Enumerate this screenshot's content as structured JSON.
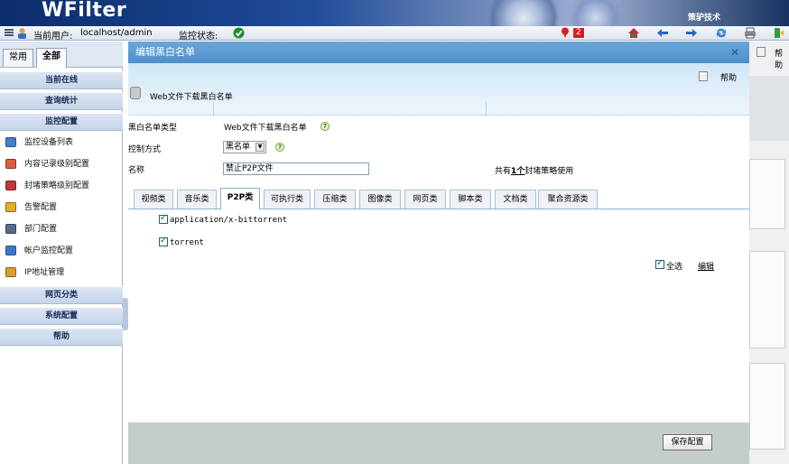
{
  "app": {
    "logo": "WFilter",
    "company": "策驴技术"
  },
  "statusbar": {
    "current_user_label": "当前用户:",
    "current_user": "localhost/admin",
    "monitor_status_label": "监控状态:",
    "alert_count": "2"
  },
  "sidebar": {
    "tabs": [
      "常用",
      "全部"
    ],
    "active_tab": "全部",
    "groups": [
      {
        "label": "当前在线"
      },
      {
        "label": "查询统计"
      },
      {
        "label": "监控配置"
      }
    ],
    "items": [
      {
        "label": "监控设备列表",
        "icon": "monitor-icon"
      },
      {
        "label": "内容记录级别配置",
        "icon": "record-icon"
      },
      {
        "label": "封堵策略级别配置",
        "icon": "block-icon"
      },
      {
        "label": "告警配置",
        "icon": "alert-icon"
      },
      {
        "label": "部门配置",
        "icon": "department-icon"
      },
      {
        "label": "帐户监控配置",
        "icon": "account-icon"
      },
      {
        "label": "IP地址管理",
        "icon": "ip-icon"
      }
    ],
    "groups_bottom": [
      {
        "label": "网页分类"
      },
      {
        "label": "系统配置"
      },
      {
        "label": "帮助"
      }
    ]
  },
  "dialog": {
    "title": "编辑黑白名单",
    "help": "帮助",
    "subtitle": "Web文件下载黑白名单",
    "type_label": "黑白名单类型",
    "type_value": "Web文件下载黑白名单",
    "mode_label": "控制方式",
    "mode_value": "黑名单",
    "name_label": "名称",
    "name_value": "禁止P2P文件",
    "policy_count_prefix": "共有",
    "policy_count_link": "1个",
    "policy_count_suffix": "封堵策略使用",
    "category_tabs": [
      "视频类",
      "音乐类",
      "P2P类",
      "可执行类",
      "压缩类",
      "图像类",
      "网页类",
      "脚本类",
      "文档类",
      "聚合资源类"
    ],
    "active_category": "P2P类",
    "entries": [
      {
        "label": "application/x-bittorrent",
        "checked": true
      },
      {
        "label": "torrent",
        "checked": true
      }
    ],
    "select_all": "全选",
    "edit": "编辑",
    "save_button": "保存配置"
  },
  "right_panel": {
    "help": "帮助"
  },
  "colors": {
    "title_bar": "#4e8fcb",
    "footer": "#c4cccc",
    "sidebar_head": "#c5d4e9"
  }
}
